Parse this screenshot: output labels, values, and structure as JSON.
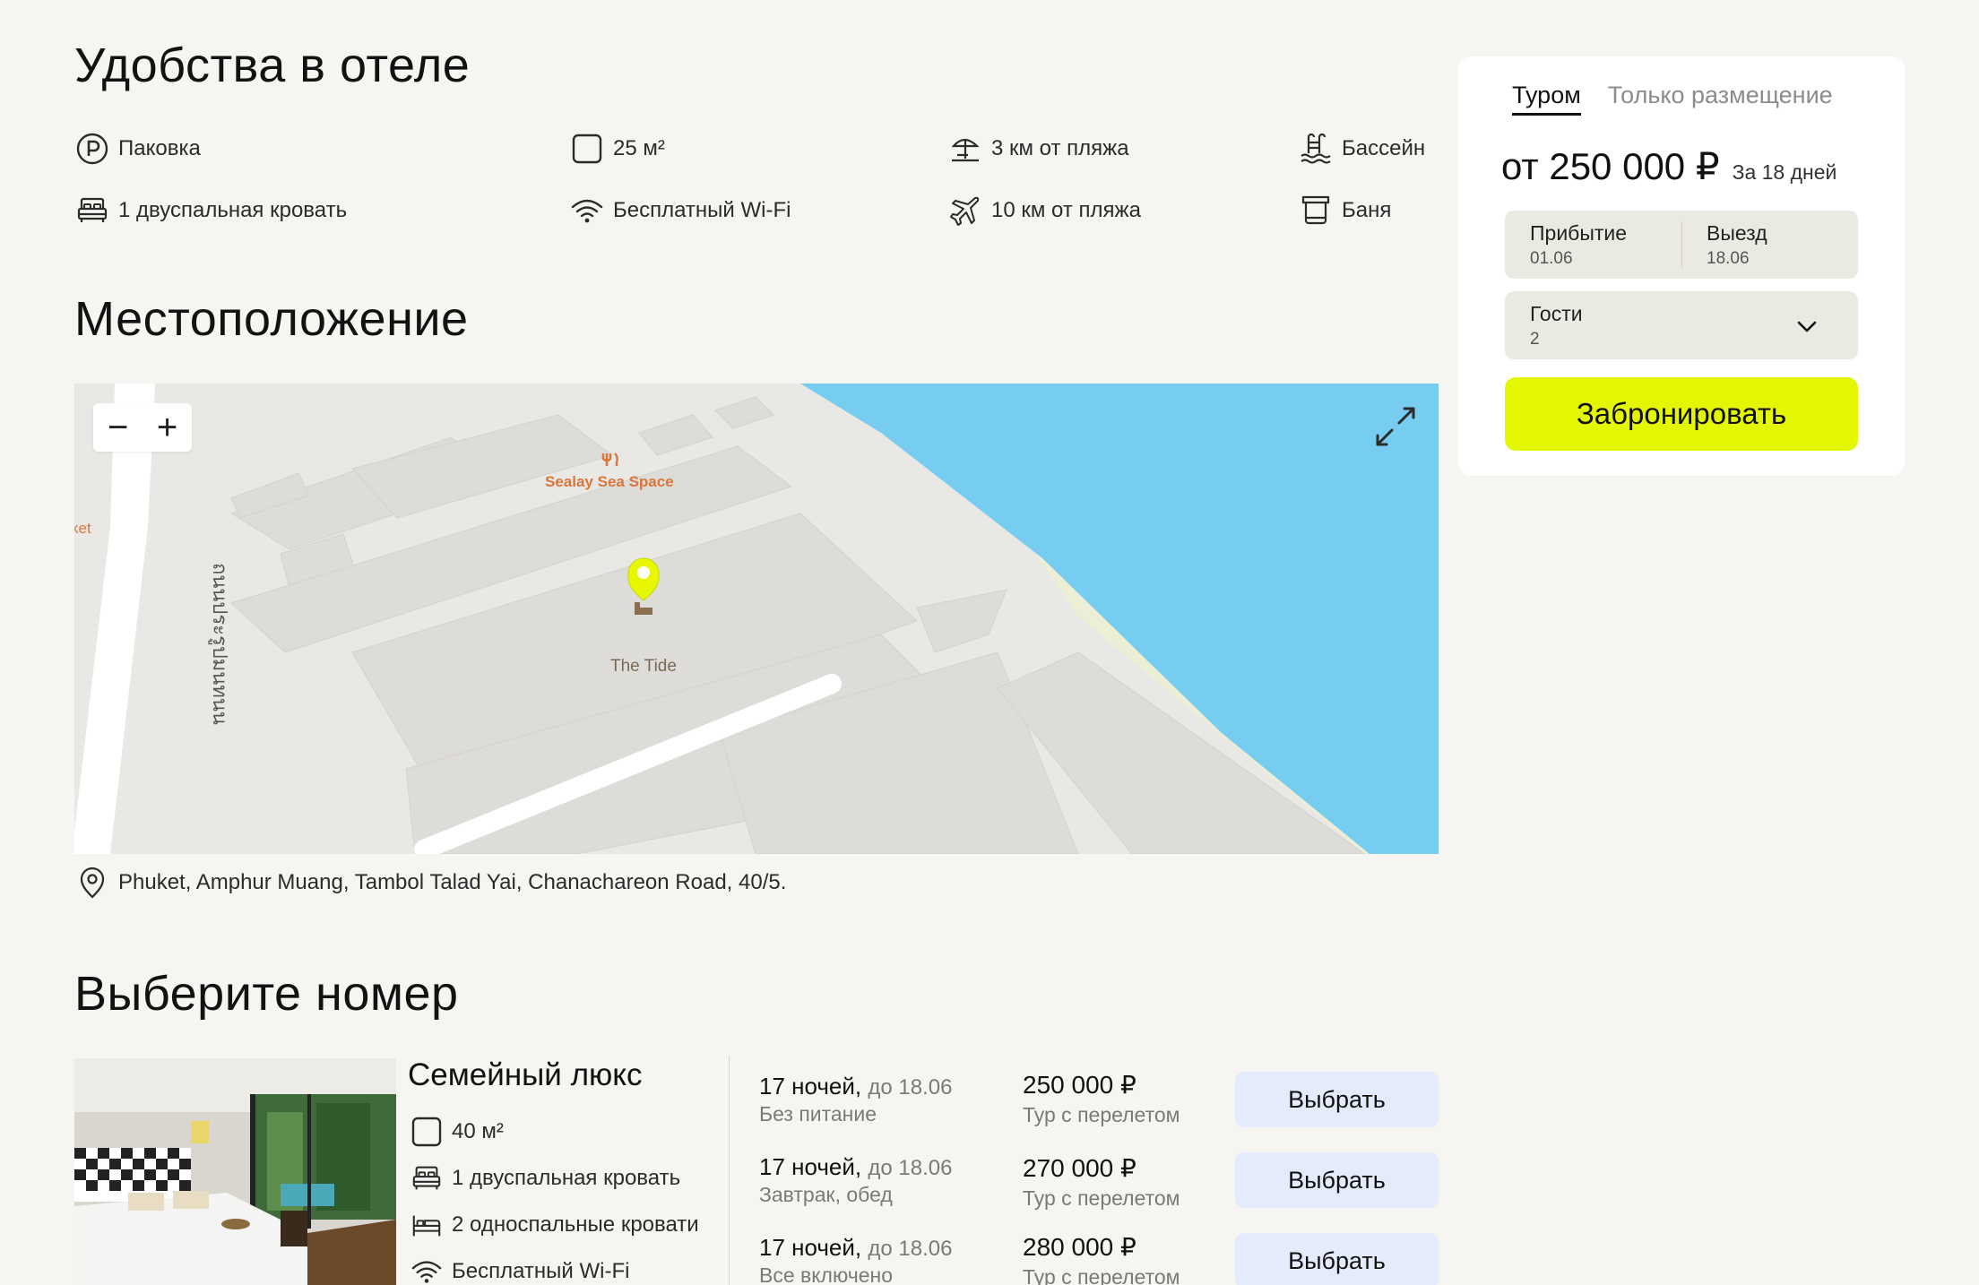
{
  "amenities": {
    "title": "Удобства в отеле",
    "items": [
      {
        "label": "Паковка",
        "icon": "parking-icon"
      },
      {
        "label": "25 м²",
        "icon": "area-icon"
      },
      {
        "label": "3 км от пляжа",
        "icon": "beach-icon"
      },
      {
        "label": "Бассейн",
        "icon": "pool-icon"
      },
      {
        "label": "1 двуспальная кровать",
        "icon": "double-bed-icon"
      },
      {
        "label": "Бесплатный Wi-Fi",
        "icon": "wifi-icon"
      },
      {
        "label": "10 км от пляжа",
        "icon": "plane-icon"
      },
      {
        "label": "Баня",
        "icon": "sauna-icon"
      }
    ]
  },
  "location": {
    "title": "Местоположение",
    "map": {
      "zoom_out": "−",
      "zoom_in": "+",
      "poi_restaurant": "Sealay Sea Space",
      "poi_hotel": "The Tide",
      "street": "ถนนประรูปมนทนน",
      "edge_label": "ket",
      "colors": {
        "sea": "#76cdf0",
        "sand": "#eceed5",
        "land": "#e9e8e4",
        "building": "#dedcd8",
        "pin": "#e6f700",
        "poi": "#d9763c"
      }
    },
    "address": "Phuket, Amphur Muang, Tambol Talad Yai, Chanachareon Road, 40/5."
  },
  "booking": {
    "tabs": [
      "Туром",
      "Только размещение"
    ],
    "active_tab": "Туром",
    "price": "от 250 000 ₽",
    "price_note": "За 18 дней",
    "arrival_label": "Прибытие",
    "arrival_value": "01.06",
    "departure_label": "Выезд",
    "departure_value": "18.06",
    "guests_label": "Гости",
    "guests_value": "2",
    "book_button": "Забронировать",
    "accent_color": "#e3f700"
  },
  "rooms": {
    "title": "Выберите номер",
    "room": {
      "name": "Семейный люкс",
      "features": [
        {
          "label": "40 м²",
          "icon": "area-icon"
        },
        {
          "label": "1 двуспальная кровать",
          "icon": "double-bed-icon"
        },
        {
          "label": "2 односпальные кровати",
          "icon": "single-bed-icon"
        },
        {
          "label": "Бесплатный Wi-Fi",
          "icon": "wifi-icon"
        }
      ],
      "offers": [
        {
          "nights": "17 ночей,",
          "until": "до 18.06",
          "meal": "Без питание",
          "price": "250 000 ₽",
          "type": "Тур с перелетом",
          "button": "Выбрать"
        },
        {
          "nights": "17 ночей,",
          "until": "до 18.06",
          "meal": "Завтрак, обед",
          "price": "270 000 ₽",
          "type": "Тур с перелетом",
          "button": "Выбрать"
        },
        {
          "nights": "17 ночей,",
          "until": "до 18.06",
          "meal": "Все включено",
          "price": "280 000 ₽",
          "type": "Тур с перелетом",
          "button": "Выбрать"
        }
      ]
    }
  }
}
